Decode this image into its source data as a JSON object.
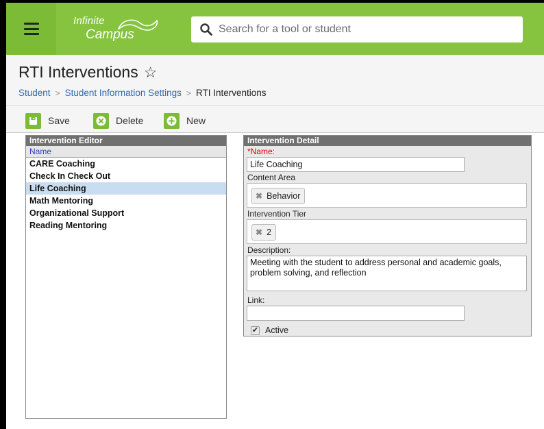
{
  "header": {
    "logo_line1": "Infinite",
    "logo_line2": "Campus",
    "search_placeholder": "Search for a tool or student",
    "brand_color": "#86c440"
  },
  "page": {
    "title": "RTI Interventions",
    "breadcrumb": [
      "Student",
      "Student Information Settings",
      "RTI Interventions"
    ]
  },
  "toolbar": {
    "save_label": "Save",
    "delete_label": "Delete",
    "new_label": "New"
  },
  "editor": {
    "heading": "Intervention Editor",
    "column_header": "Name",
    "items": [
      "CARE Coaching",
      "Check In Check Out",
      "Life Coaching",
      "Math Mentoring",
      "Organizational Support",
      "Reading Mentoring"
    ],
    "selected_index": 2
  },
  "detail": {
    "heading": "Intervention Detail",
    "name_required_mark": "*",
    "name_label": "Name:",
    "name_value": "Life Coaching",
    "content_area_label": "Content Area",
    "content_area_tag": "Behavior",
    "tier_label": "Intervention Tier",
    "tier_tag": "2",
    "description_label": "Description:",
    "description_value": "Meeting with the student to address personal and academic goals, problem solving, and reflection",
    "link_label": "Link:",
    "link_value": "",
    "active_label": "Active",
    "active_checked": true
  }
}
